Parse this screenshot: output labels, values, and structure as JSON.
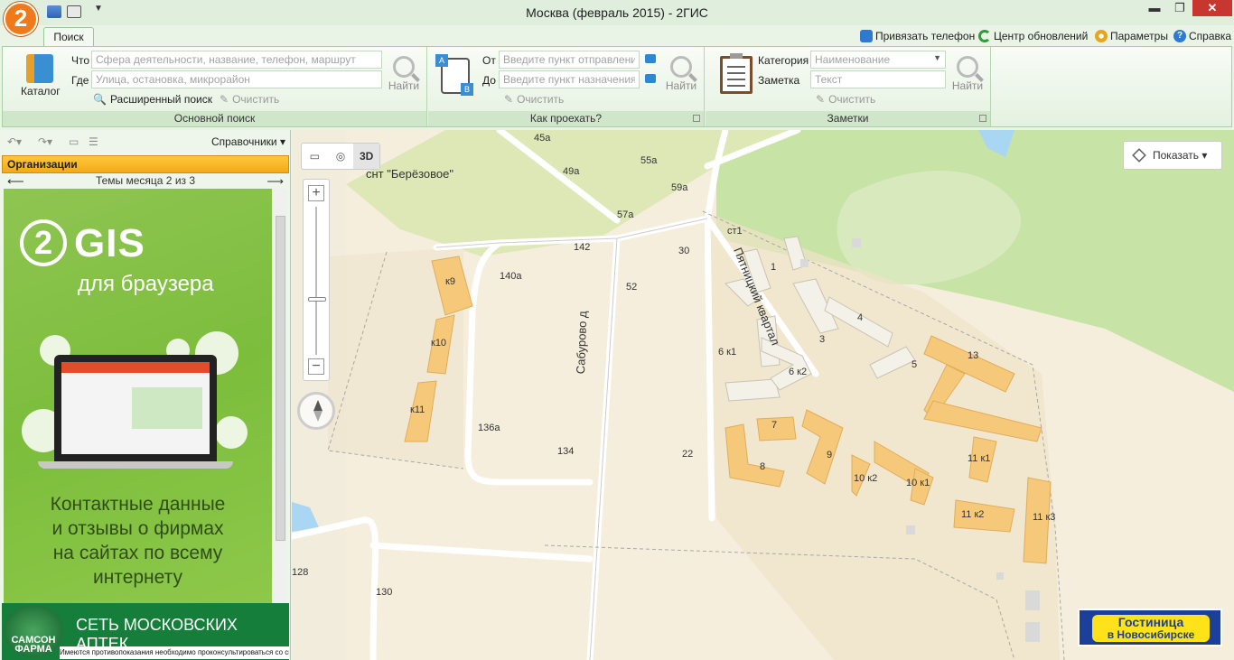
{
  "window": {
    "title": "Москва (февраль 2015) - 2ГИС",
    "logo_text": "2",
    "min": "▬",
    "max": "❐",
    "close": "✕"
  },
  "ribbon_tabs": {
    "search_tab": "Поиск"
  },
  "top_links": {
    "phone": "Привязать телефон",
    "updates": "Центр обновлений",
    "params": "Параметры",
    "help": "Справка"
  },
  "main_search": {
    "catalog_label": "Каталог",
    "what_label": "Что",
    "what_placeholder": "Сфера деятельности, название, телефон, маршрут",
    "where_label": "Где",
    "where_placeholder": "Улица, остановка, микрорайон",
    "find_label": "Найти",
    "advanced_label": "Расширенный поиск",
    "clear_label": "Очистить",
    "group_title": "Основной поиск"
  },
  "route": {
    "from_label": "От",
    "from_placeholder": "Введите пункт отправления",
    "to_label": "До",
    "to_placeholder": "Введите пункт назначения",
    "find_label": "Найти",
    "clear_label": "Очистить",
    "group_title": "Как проехать?"
  },
  "notes": {
    "category_label": "Категория",
    "category_placeholder": "Наименование",
    "note_label": "Заметка",
    "note_placeholder": "Текст",
    "find_label": "Найти",
    "clear_label": "Очистить",
    "group_title": "Заметки"
  },
  "left_panel": {
    "directories_label": "Справочники",
    "org_header": "Организации",
    "themes_label": "Темы месяца 2 из 3",
    "promo": {
      "logo": "2",
      "brand": "GIS",
      "subtitle": "для браузера",
      "text_line1": "Контактные данные",
      "text_line2": "и отзывы о фирмах",
      "text_line3": "на сайтах по всему",
      "text_line4": "интернету"
    },
    "pharmacy_ad": {
      "logo_line1": "САМСОН",
      "logo_line2": "ФАРМА",
      "title": "СЕТЬ МОСКОВСКИХ АПТЕК",
      "warning": "Имеются противопоказания необходимо проконсультироваться со специалистом"
    }
  },
  "map": {
    "mode_3d": "3D",
    "zoom_in": "+",
    "zoom_out": "−",
    "show_button": "Показать",
    "area_label": "снт \"Берёзовое\"",
    "street_saburovo": "Сабурово д",
    "street_pyatnitsky": "Пятницкий квартал",
    "hotel_ad_line1": "Гостиница",
    "hotel_ad_line2": "в Новосибирске",
    "labels": [
      "45а",
      "49а",
      "55а",
      "59а",
      "57а",
      "142",
      "30",
      "ст1",
      "1",
      "140а",
      "52",
      "к9",
      "к10",
      "4",
      "3",
      "13",
      "6 к1",
      "6 к2",
      "5",
      "к11",
      "7",
      "136а",
      "9",
      "134",
      "8",
      "22",
      "11 к1",
      "10 к2",
      "10 к1",
      "11 к2",
      "11 к3",
      "128",
      "130"
    ]
  }
}
